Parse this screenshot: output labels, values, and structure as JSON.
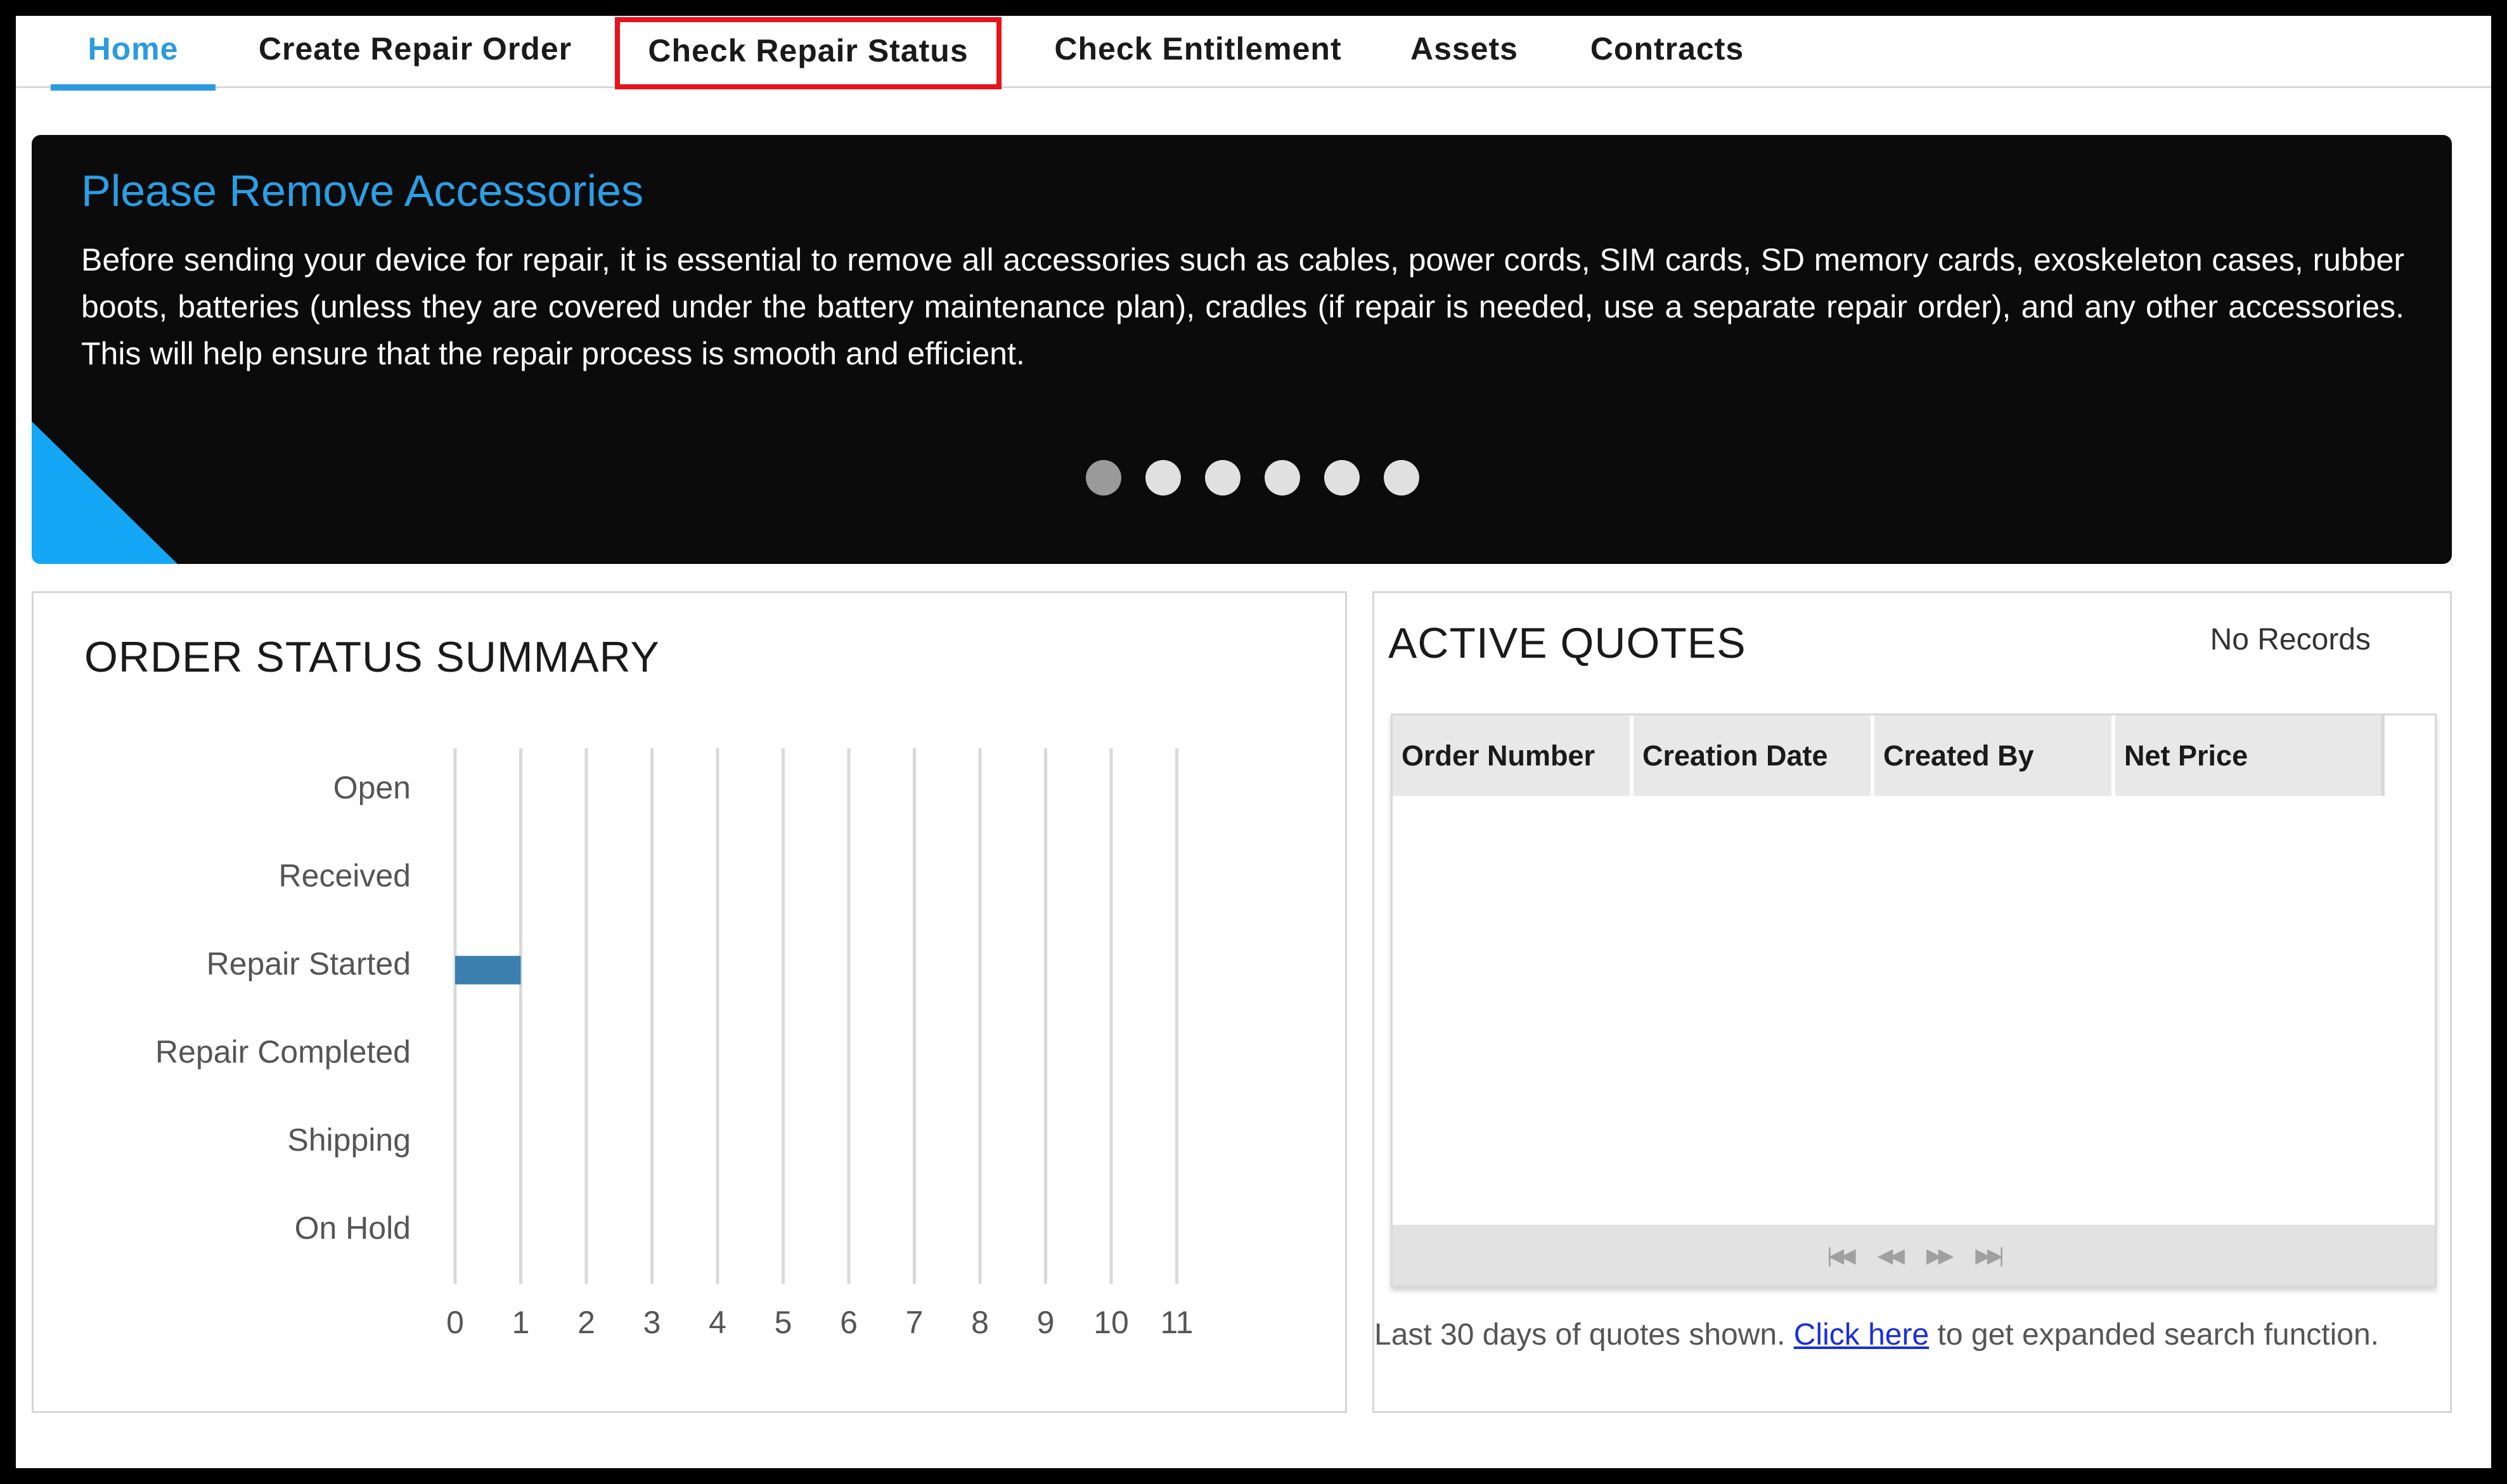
{
  "nav": {
    "items": [
      {
        "label": "Home"
      },
      {
        "label": "Create Repair Order"
      },
      {
        "label": "Check Repair Status"
      },
      {
        "label": "Check Entitlement"
      },
      {
        "label": "Assets"
      },
      {
        "label": "Contracts"
      }
    ],
    "active": "Home",
    "highlighted": "Check Repair Status"
  },
  "banner": {
    "title": "Please Remove Accessories",
    "text": "Before sending your device for repair, it is essential to remove all accessories such as cables, power cords, SIM cards, SD memory cards, exoskeleton cases, rubber boots, batteries (unless they are covered under the battery maintenance plan), cradles (if repair is needed, use a separate repair order), and any other accessories. This will help ensure that the repair process is smooth and efficient.",
    "slide_count": 6,
    "active_slide": 1
  },
  "order_status": {
    "title": "ORDER STATUS SUMMARY"
  },
  "chart_data": {
    "type": "bar",
    "orientation": "horizontal",
    "categories": [
      "Open",
      "Received",
      "Repair Started",
      "Repair Completed",
      "Shipping",
      "On Hold"
    ],
    "values": [
      0,
      0,
      1,
      0,
      0,
      0
    ],
    "xticks": [
      "0",
      "1",
      "2",
      "3",
      "4",
      "5",
      "6",
      "7",
      "8",
      "9",
      "10",
      "11"
    ],
    "xlim": [
      0,
      11
    ],
    "grid": true,
    "bar_color": "#3a7fae"
  },
  "active_quotes": {
    "title": "ACTIVE QUOTES",
    "no_records": "No Records",
    "columns": [
      "Order Number",
      "Creation Date",
      "Created By",
      "Net Price"
    ],
    "rows": [],
    "pager": [
      "first-page-icon",
      "prev-page-icon",
      "next-page-icon",
      "last-page-icon"
    ],
    "footnote_before": "Last 30 days of quotes shown. ",
    "footnote_link": "Click here",
    "footnote_after": " to get expanded search function."
  },
  "colors": {
    "accent": "#2b9be0",
    "highlight_border": "#e8121c",
    "banner_bg": "#0b0b0b",
    "bar": "#3a7fae"
  }
}
